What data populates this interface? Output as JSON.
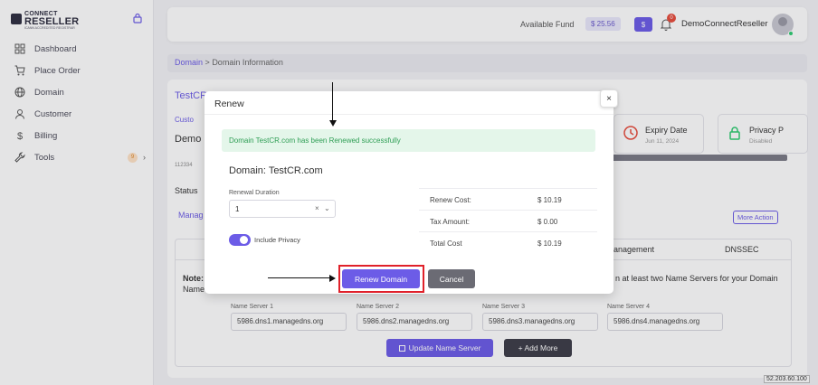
{
  "app": {
    "logo_line1": "CONNECT",
    "logo_line2": "RESELLER",
    "logo_tagline": "ICANN ACCREDITED REGISTRAR"
  },
  "sidebar": {
    "items": [
      {
        "label": "Dashboard",
        "icon": "grid-icon"
      },
      {
        "label": "Place Order",
        "icon": "cart-icon"
      },
      {
        "label": "Domain",
        "icon": "globe-icon"
      },
      {
        "label": "Customer",
        "icon": "user-icon"
      },
      {
        "label": "Billing",
        "icon": "dollar-icon"
      },
      {
        "label": "Tools",
        "icon": "wrench-icon",
        "badge": "9"
      }
    ]
  },
  "header": {
    "fund_label": "Available Fund",
    "fund_value": "$ 25.56",
    "dollar_button": "$",
    "notification_count": "0",
    "username": "DemoConnectReseller"
  },
  "breadcrumb": {
    "root": "Domain",
    "separator": ">",
    "current": "Domain Information"
  },
  "background": {
    "title": "TestCR",
    "customer_label": "Custo",
    "customer_name": "Demo",
    "customer_id": "112334",
    "status_label": "Status",
    "manage_tab": "Manag",
    "expiry_title": "Expiry Date",
    "expiry_value": "Jun 11, 2024",
    "privacy_title": "Privacy P",
    "privacy_value": "Disabled",
    "more_action": "More Action",
    "tab_management": "anagement",
    "tab_dnssec": "DNSSEC",
    "note_label": "Note:",
    "note_label2": "Name",
    "note_text": "n at least two Name Servers for your Domain",
    "name_servers": [
      {
        "label": "Name Server 1",
        "value": "5986.dns1.managedns.org"
      },
      {
        "label": "Name Server 2",
        "value": "5986.dns2.managedns.org"
      },
      {
        "label": "Name Server 3",
        "value": "5986.dns3.managedns.org"
      },
      {
        "label": "Name Server 4",
        "value": "5986.dns4.managedns.org"
      }
    ],
    "update_button": "Update Name Server",
    "add_more_button": "+ Add More"
  },
  "modal": {
    "title": "Renew",
    "close": "×",
    "success_message": "Domain TestCR.com has been Renewed successfully",
    "domain_heading": "Domain: TestCR.com",
    "duration_label": "Renewal Duration",
    "duration_value": "1",
    "duration_clear": "×",
    "duration_chevron": "⌄",
    "privacy_label": "Include Privacy",
    "privacy_on": true,
    "costs": [
      {
        "label": "Renew Cost:",
        "value": "$ 10.19"
      },
      {
        "label": "Tax Amount:",
        "value": "$ 0.00"
      },
      {
        "label": "Total Cost",
        "value": "$ 10.19"
      }
    ],
    "renew_button": "Renew Domain",
    "cancel_button": "Cancel"
  },
  "footer": {
    "ip": "52.203.60.100"
  },
  "colors": {
    "accent": "#6c5ce7",
    "success_bg": "#e4f6ea",
    "success_text": "#2f9e55",
    "highlight": "#e0212a"
  }
}
